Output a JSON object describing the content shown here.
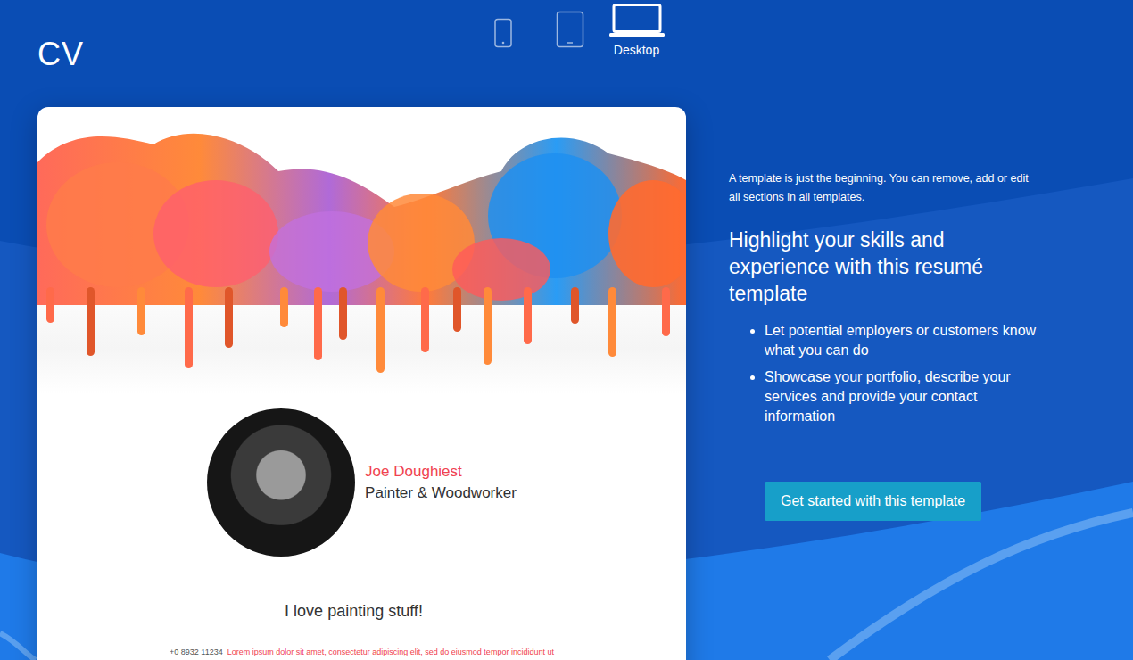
{
  "page": {
    "title": "CV"
  },
  "devices": [
    {
      "kind": "phone",
      "label": "",
      "selected": false
    },
    {
      "kind": "tablet",
      "label": "",
      "selected": false
    },
    {
      "kind": "desktop",
      "label": "Desktop",
      "selected": true
    }
  ],
  "preview": {
    "name": "Joe Doughiest",
    "role": "Painter & Woodworker",
    "tagline": "I love painting stuff!",
    "phone": "+0 8932 11234",
    "lorem": "Lorem ipsum dolor sit amet, consectetur adipiscing elit, sed do eiusmod tempor incididunt ut"
  },
  "info": {
    "note": "A template is just the beginning. You can remove, add or edit all sections in all templates.",
    "heading": "Highlight your skills and experience with this resumé template",
    "bullets": [
      "Let potential employers or customers know what you can do",
      "Showcase your portfolio, describe your services and provide your contact information"
    ],
    "button": "Get started with this template"
  }
}
